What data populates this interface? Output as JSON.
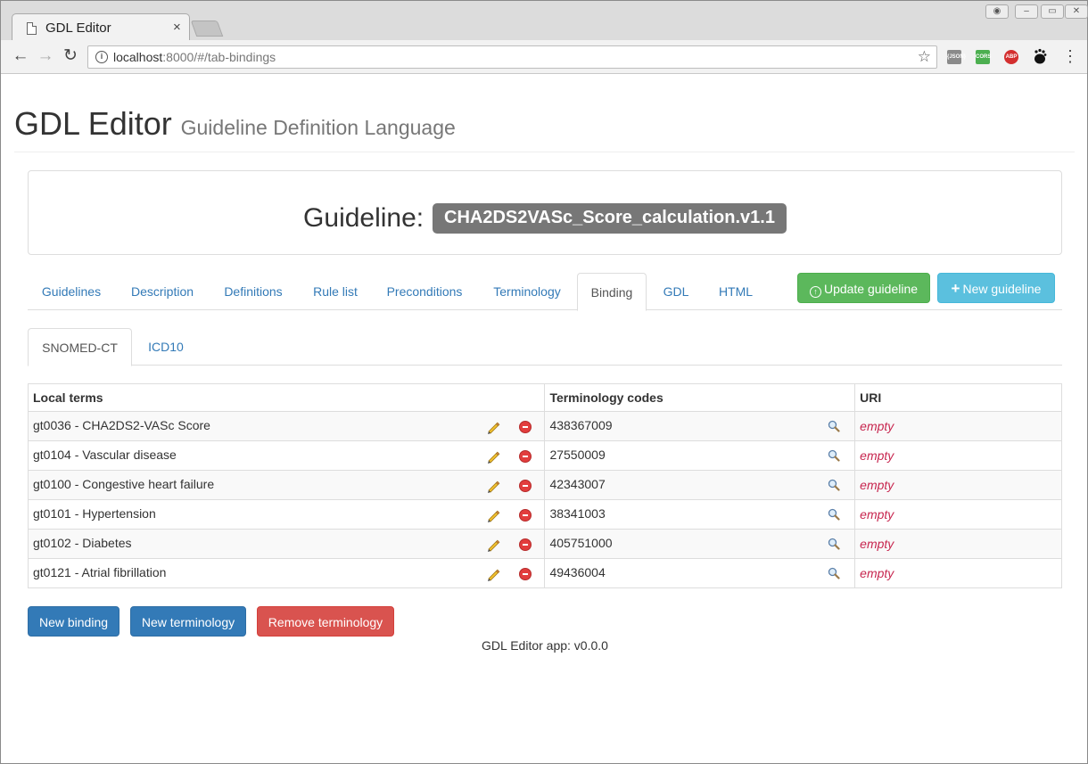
{
  "browser": {
    "tab_title": "GDL Editor",
    "tab_close": "×",
    "url_host": "localhost",
    "url_rest": ":8000/#/tab-bindings",
    "extensions": [
      {
        "name": "json-ext",
        "label": "{JSON}",
        "color": "#8a8a8a"
      },
      {
        "name": "cors-ext",
        "label": "CORS",
        "color": "#4caf50"
      },
      {
        "name": "abp-ext",
        "label": "ABP",
        "color": "#d32f2f"
      }
    ]
  },
  "header": {
    "title": "GDL Editor",
    "subtitle": "Guideline Definition Language"
  },
  "guideline": {
    "label": "Guideline:",
    "name": "CHA2DS2VASc_Score_calculation.v1.1"
  },
  "tabs": [
    {
      "label": "Guidelines"
    },
    {
      "label": "Description"
    },
    {
      "label": "Definitions"
    },
    {
      "label": "Rule list"
    },
    {
      "label": "Preconditions"
    },
    {
      "label": "Terminology"
    },
    {
      "label": "Binding",
      "active": true
    },
    {
      "label": "GDL"
    },
    {
      "label": "HTML"
    }
  ],
  "actions": {
    "update_label": "Update guideline",
    "new_label": "New guideline"
  },
  "subtabs": [
    {
      "label": "SNOMED-CT",
      "active": true
    },
    {
      "label": "ICD10"
    }
  ],
  "table": {
    "headers": [
      "Local terms",
      "Terminology codes",
      "URI"
    ],
    "rows": [
      {
        "term": "gt0036 - CHA2DS2-VASc Score",
        "code": "438367009",
        "uri": "empty"
      },
      {
        "term": "gt0104 - Vascular disease",
        "code": "27550009",
        "uri": "empty"
      },
      {
        "term": "gt0100 - Congestive heart failure",
        "code": "42343007",
        "uri": "empty"
      },
      {
        "term": "gt0101 - Hypertension",
        "code": "38341003",
        "uri": "empty"
      },
      {
        "term": "gt0102 - Diabetes",
        "code": "405751000",
        "uri": "empty"
      },
      {
        "term": "gt0121 - Atrial fibrillation",
        "code": "49436004",
        "uri": "empty"
      }
    ]
  },
  "buttons": {
    "new_binding": "New binding",
    "new_terminology": "New terminology",
    "remove_terminology": "Remove terminology"
  },
  "footer": {
    "version": "GDL Editor app: v0.0.0"
  },
  "colors": {
    "link": "#337ab7",
    "success": "#5cb85c",
    "info": "#5bc0de",
    "primary": "#337ab7",
    "danger": "#d9534f",
    "empty": "#c7254e",
    "badge": "#777777"
  }
}
